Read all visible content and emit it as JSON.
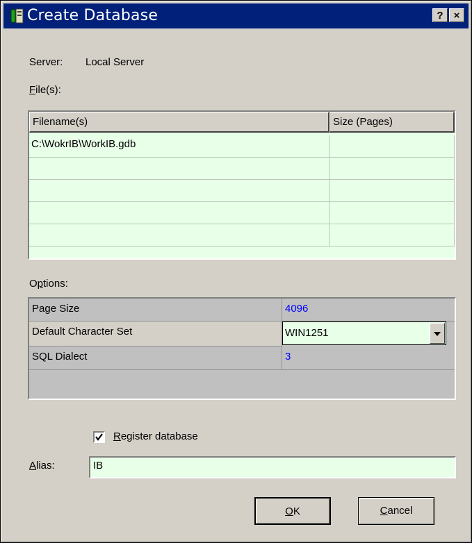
{
  "window": {
    "title": "Create Database",
    "help_button": "?",
    "close_button": "×"
  },
  "server": {
    "label": "Server:",
    "value": "Local Server"
  },
  "files": {
    "label_accel": "F",
    "label_rest": "ile(s):",
    "columns": [
      "Filename(s)",
      "Size (Pages)"
    ],
    "rows": [
      [
        "C:\\WokrIB\\WorkIB.gdb",
        ""
      ],
      [
        "",
        ""
      ],
      [
        "",
        ""
      ],
      [
        "",
        ""
      ],
      [
        "",
        ""
      ]
    ]
  },
  "options": {
    "label_accel": "p",
    "label_pre": "O",
    "label_rest": "tions:",
    "rows": [
      {
        "name": "Page Size",
        "value": "4096"
      },
      {
        "name": "Default Character Set",
        "value": "WIN1251"
      },
      {
        "name": "SQL Dialect",
        "value": "3"
      }
    ]
  },
  "register": {
    "checked": true,
    "label_accel": "R",
    "label_rest": "egister database"
  },
  "alias": {
    "label_accel": "A",
    "label_rest": "lias:",
    "value": "IB"
  },
  "buttons": {
    "ok_accel": "O",
    "ok_rest": "K",
    "cancel_accel": "C",
    "cancel_rest": "ancel"
  },
  "colors": {
    "title_bar": "#00207a",
    "grid_bg": "#e8ffe8",
    "value_text": "#0000ff"
  }
}
